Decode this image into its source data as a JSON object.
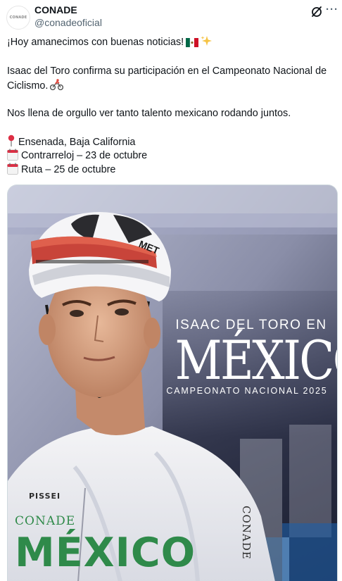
{
  "post": {
    "author_name": "CONADE",
    "author_handle": "@conadeoficial",
    "avatar_text": "CONADE",
    "lines": {
      "l1": "¡Hoy amanecimos con buenas noticias!",
      "l2": "Isaac del Toro confirma su participación en el Campeonato Nacional de",
      "l3": "Ciclismo.",
      "l4": "Nos llena de orgullo ver tanto talento mexicano rodando juntos.",
      "l5": "Ensenada, Baja California",
      "l6": "Contrarreloj – 23 de octubre",
      "l7": "Ruta – 25 de octubre"
    },
    "icons": {
      "flag": "mexico-flag-icon",
      "sparkles": "sparkles-icon",
      "cyclist": "cyclist-icon",
      "pin": "round-pushpin-icon",
      "calendar": "calendar-icon"
    }
  },
  "media": {
    "overlay_name": "ISAAC DEL TORO EN",
    "overlay_title": "MÉXICO",
    "overlay_subtitle": "CAMPEONATO NACIONAL 2025",
    "helmet_brand": "MET",
    "jersey_sponsor": "PISSEI",
    "jersey_org": "CONADE",
    "jersey_country": "MÉXICO",
    "jersey_side": "CONADE"
  },
  "colors": {
    "text": "#0f1419",
    "secondary": "#536471",
    "jersey_green": "#2f8a4a",
    "overlay_text": "#ffffff"
  }
}
